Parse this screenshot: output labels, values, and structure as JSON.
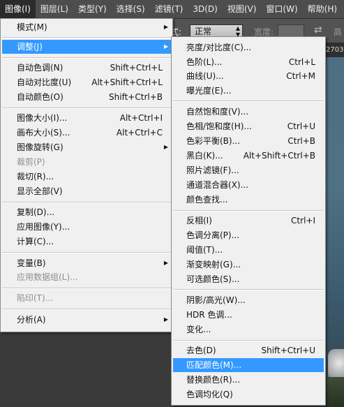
{
  "menubar": {
    "items": [
      {
        "label": "图像(I)",
        "active": true
      },
      {
        "label": "图层(L)"
      },
      {
        "label": "类型(Y)"
      },
      {
        "label": "选择(S)"
      },
      {
        "label": "滤镜(T)"
      },
      {
        "label": "3D(D)"
      },
      {
        "label": "视图(V)"
      },
      {
        "label": "窗口(W)"
      },
      {
        "label": "帮助(H)"
      }
    ]
  },
  "options_bar": {
    "mode_label": "式:",
    "mode_value": "正常",
    "width_label": "宽度:",
    "height_label": "高"
  },
  "document": {
    "tab_text": "2703"
  },
  "image_menu": {
    "items": [
      {
        "label": "模式(M)",
        "shortcut": "",
        "submenu": true
      },
      {
        "label": "调整(J)",
        "shortcut": "",
        "submenu": true,
        "highlighted": true
      },
      {
        "label": "自动色调(N)",
        "shortcut": "Shift+Ctrl+L"
      },
      {
        "label": "自动对比度(U)",
        "shortcut": "Alt+Shift+Ctrl+L"
      },
      {
        "label": "自动颜色(O)",
        "shortcut": "Shift+Ctrl+B"
      },
      {
        "label": "图像大小(I)...",
        "shortcut": "Alt+Ctrl+I"
      },
      {
        "label": "画布大小(S)...",
        "shortcut": "Alt+Ctrl+C"
      },
      {
        "label": "图像旋转(G)",
        "shortcut": "",
        "submenu": true
      },
      {
        "label": "裁剪(P)",
        "shortcut": "",
        "disabled": true
      },
      {
        "label": "裁切(R)...",
        "shortcut": ""
      },
      {
        "label": "显示全部(V)",
        "shortcut": ""
      },
      {
        "label": "复制(D)...",
        "shortcut": ""
      },
      {
        "label": "应用图像(Y)...",
        "shortcut": ""
      },
      {
        "label": "计算(C)...",
        "shortcut": ""
      },
      {
        "label": "变量(B)",
        "shortcut": "",
        "submenu": true
      },
      {
        "label": "应用数据组(L)...",
        "shortcut": "",
        "disabled": true
      },
      {
        "label": "陷印(T)...",
        "shortcut": "",
        "disabled": true
      },
      {
        "label": "分析(A)",
        "shortcut": "",
        "submenu": true
      }
    ]
  },
  "adjust_menu": {
    "items": [
      {
        "label": "亮度/对比度(C)...",
        "shortcut": ""
      },
      {
        "label": "色阶(L)...",
        "shortcut": "Ctrl+L"
      },
      {
        "label": "曲线(U)...",
        "shortcut": "Ctrl+M"
      },
      {
        "label": "曝光度(E)...",
        "shortcut": ""
      },
      {
        "label": "自然饱和度(V)...",
        "shortcut": ""
      },
      {
        "label": "色相/饱和度(H)...",
        "shortcut": "Ctrl+U"
      },
      {
        "label": "色彩平衡(B)...",
        "shortcut": "Ctrl+B"
      },
      {
        "label": "黑白(K)...",
        "shortcut": "Alt+Shift+Ctrl+B"
      },
      {
        "label": "照片滤镜(F)...",
        "shortcut": ""
      },
      {
        "label": "通道混合器(X)...",
        "shortcut": ""
      },
      {
        "label": "颜色查找...",
        "shortcut": ""
      },
      {
        "label": "反相(I)",
        "shortcut": "Ctrl+I"
      },
      {
        "label": "色调分离(P)...",
        "shortcut": ""
      },
      {
        "label": "阈值(T)...",
        "shortcut": ""
      },
      {
        "label": "渐变映射(G)...",
        "shortcut": ""
      },
      {
        "label": "可选颜色(S)...",
        "shortcut": ""
      },
      {
        "label": "阴影/高光(W)...",
        "shortcut": ""
      },
      {
        "label": "HDR 色调...",
        "shortcut": ""
      },
      {
        "label": "变化...",
        "shortcut": ""
      },
      {
        "label": "去色(D)",
        "shortcut": "Shift+Ctrl+U"
      },
      {
        "label": "匹配颜色(M)...",
        "shortcut": "",
        "highlighted": true
      },
      {
        "label": "替换颜色(R)...",
        "shortcut": ""
      },
      {
        "label": "色调均化(Q)",
        "shortcut": ""
      }
    ]
  },
  "colors": {
    "highlight": "#3399ff",
    "menu_bg": "#f0f0f0",
    "menubar_bg": "#4d4d4d",
    "disabled_text": "#8e8e8e"
  }
}
